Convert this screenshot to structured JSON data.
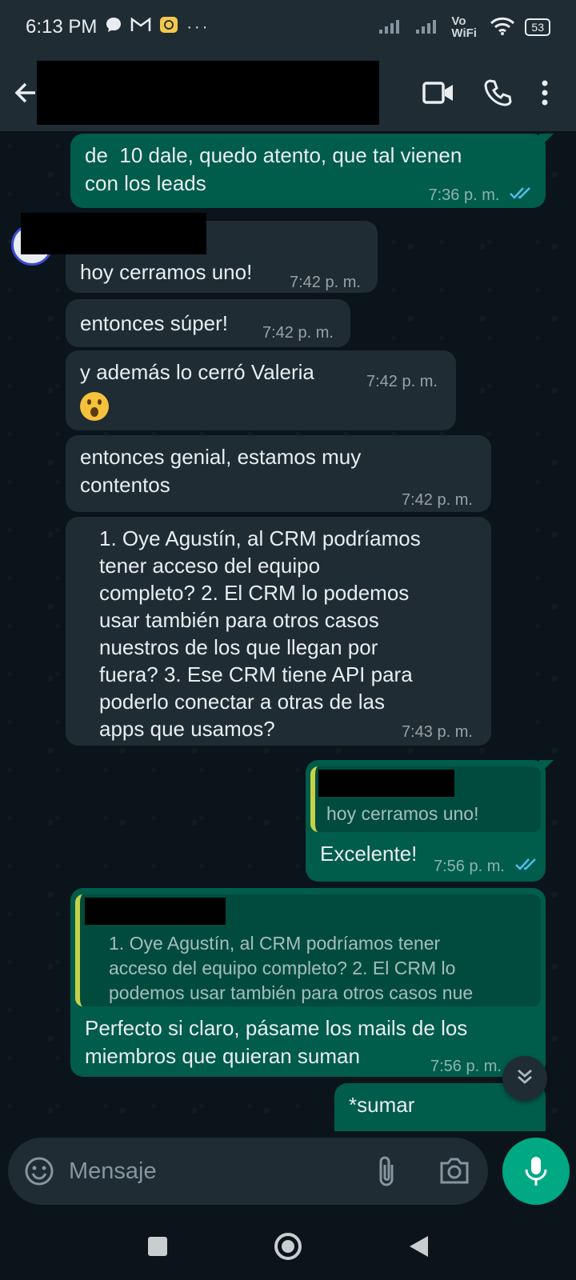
{
  "status_bar": {
    "time": "6:13 PM",
    "network_label": "Vo WiFi",
    "battery": "53"
  },
  "header": {
    "icons": [
      "back-arrow-icon",
      "video-call-icon",
      "phone-icon",
      "more-options-icon"
    ]
  },
  "messages": [
    {
      "dir": "out",
      "text": "de  10 dale, quedo atento, que tal vienen\ncon los leads",
      "time": "7:36 p. m.",
      "read": true
    },
    {
      "dir": "in",
      "text": "hoy cerramos uno!",
      "time": "7:42 p. m."
    },
    {
      "dir": "in",
      "text": "entonces súper!",
      "time": "7:42 p. m."
    },
    {
      "dir": "in",
      "text": "y además lo cerró Valeria",
      "time": "7:42 p. m."
    },
    {
      "dir": "in",
      "text": "entonces genial, estamos muy\ncontentos",
      "time": "7:42 p. m."
    },
    {
      "dir": "in",
      "text": "1. Oye Agustín, al CRM podríamos\ntener acceso del equipo\ncompleto? 2. El CRM lo podemos\nusar también para otros casos\nnuestros de los que llegan por\nfuera? 3. Ese CRM tiene API para\npoderlo conectar a otras de las\napps que usamos?",
      "time": "7:43 p. m."
    },
    {
      "dir": "out",
      "quote": "hoy cerramos uno!",
      "text": "Excelente!",
      "time": "7:56 p. m.",
      "read": true
    },
    {
      "dir": "out",
      "quote": "1. Oye Agustín, al CRM podríamos tener\nacceso del equipo completo? 2. El CRM lo\npodemos usar también para otros casos nue",
      "text": "Perfecto si claro, pásame los mails de los\nmiembros que quieran suman",
      "time": "7:56 p. m."
    },
    {
      "dir": "out",
      "text": "*sumar"
    }
  ],
  "input": {
    "placeholder": "Mensaje"
  },
  "colors": {
    "outgoing_bubble": "#005c4b",
    "incoming_bubble": "#1f2c34",
    "accent": "#00a884",
    "read_ticks": "#53bdeb"
  }
}
